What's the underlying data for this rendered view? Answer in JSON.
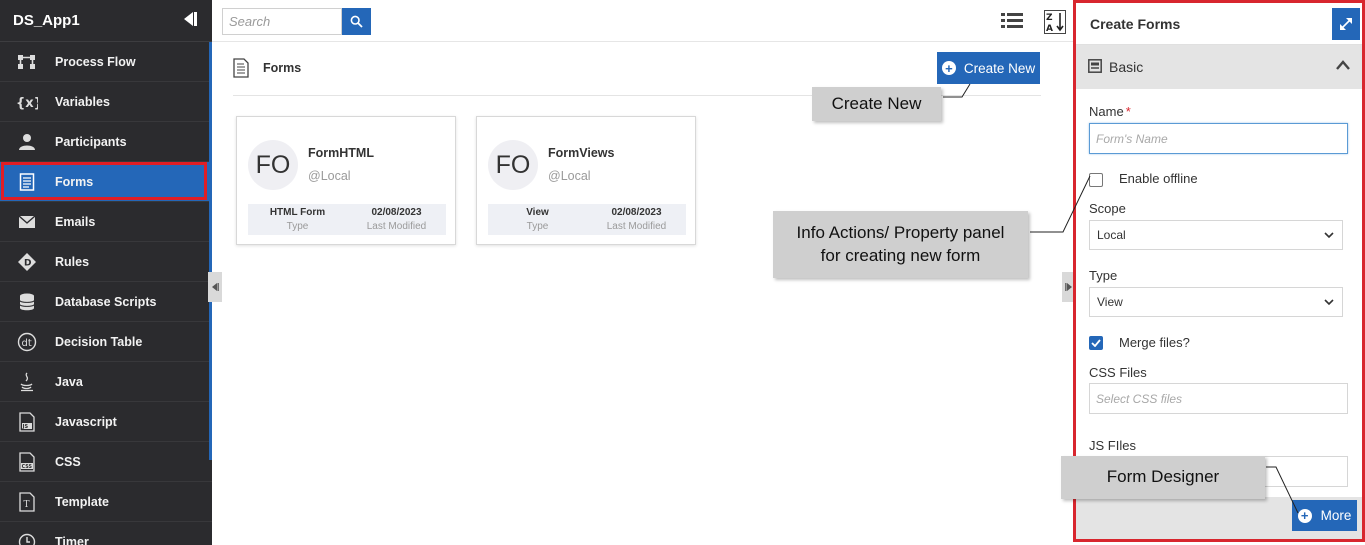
{
  "app": {
    "title": "DS_App1"
  },
  "sidebar": {
    "items": [
      {
        "label": "Process Flow",
        "icon": "process-flow-icon",
        "active": false
      },
      {
        "label": "Variables",
        "icon": "variables-icon",
        "active": false
      },
      {
        "label": "Participants",
        "icon": "participants-icon",
        "active": false
      },
      {
        "label": "Forms",
        "icon": "forms-icon",
        "active": true
      },
      {
        "label": "Emails",
        "icon": "email-icon",
        "active": false
      },
      {
        "label": "Rules",
        "icon": "rules-icon",
        "active": false
      },
      {
        "label": "Database Scripts",
        "icon": "database-icon",
        "active": false
      },
      {
        "label": "Decision Table",
        "icon": "decision-table-icon",
        "active": false
      },
      {
        "label": "Java",
        "icon": "java-icon",
        "active": false
      },
      {
        "label": "Javascript",
        "icon": "javascript-file-icon",
        "active": false
      },
      {
        "label": "CSS",
        "icon": "css-file-icon",
        "active": false
      },
      {
        "label": "Template",
        "icon": "template-icon",
        "active": false
      },
      {
        "label": "Timer",
        "icon": "timer-icon",
        "active": false
      }
    ]
  },
  "search": {
    "placeholder": "Search"
  },
  "main": {
    "heading": "Forms",
    "create_new_label": "Create New",
    "cards": [
      {
        "avatar": "FO",
        "title": "FormHTML",
        "source": "@Local",
        "type_value": "HTML Form",
        "type_key": "Type",
        "date_value": "02/08/2023",
        "date_key": "Last Modified"
      },
      {
        "avatar": "FO",
        "title": "FormViews",
        "source": "@Local",
        "type_value": "View",
        "type_key": "Type",
        "date_value": "02/08/2023",
        "date_key": "Last Modified"
      }
    ]
  },
  "callouts": {
    "create_new": "Create New",
    "info_line1": "Info Actions/ Property panel",
    "info_line2": "for creating new form",
    "form_designer": "Form Designer"
  },
  "panel": {
    "title": "Create Forms",
    "section": "Basic",
    "name_label": "Name",
    "name_required": "*",
    "name_placeholder": "Form's Name",
    "enable_offline_label": "Enable offline",
    "enable_offline_checked": false,
    "scope_label": "Scope",
    "scope_value": "Local",
    "type_label": "Type",
    "type_value": "View",
    "merge_label": "Merge files?",
    "merge_checked": true,
    "css_label": "CSS Files",
    "css_placeholder": "Select CSS files",
    "js_label": "JS FIles",
    "more_label": "More"
  },
  "colors": {
    "accent": "#2467b8",
    "sidebar_bg": "#2b2b2e",
    "highlight_border": "#d8262e",
    "callout_bg": "#cfcfcf"
  }
}
